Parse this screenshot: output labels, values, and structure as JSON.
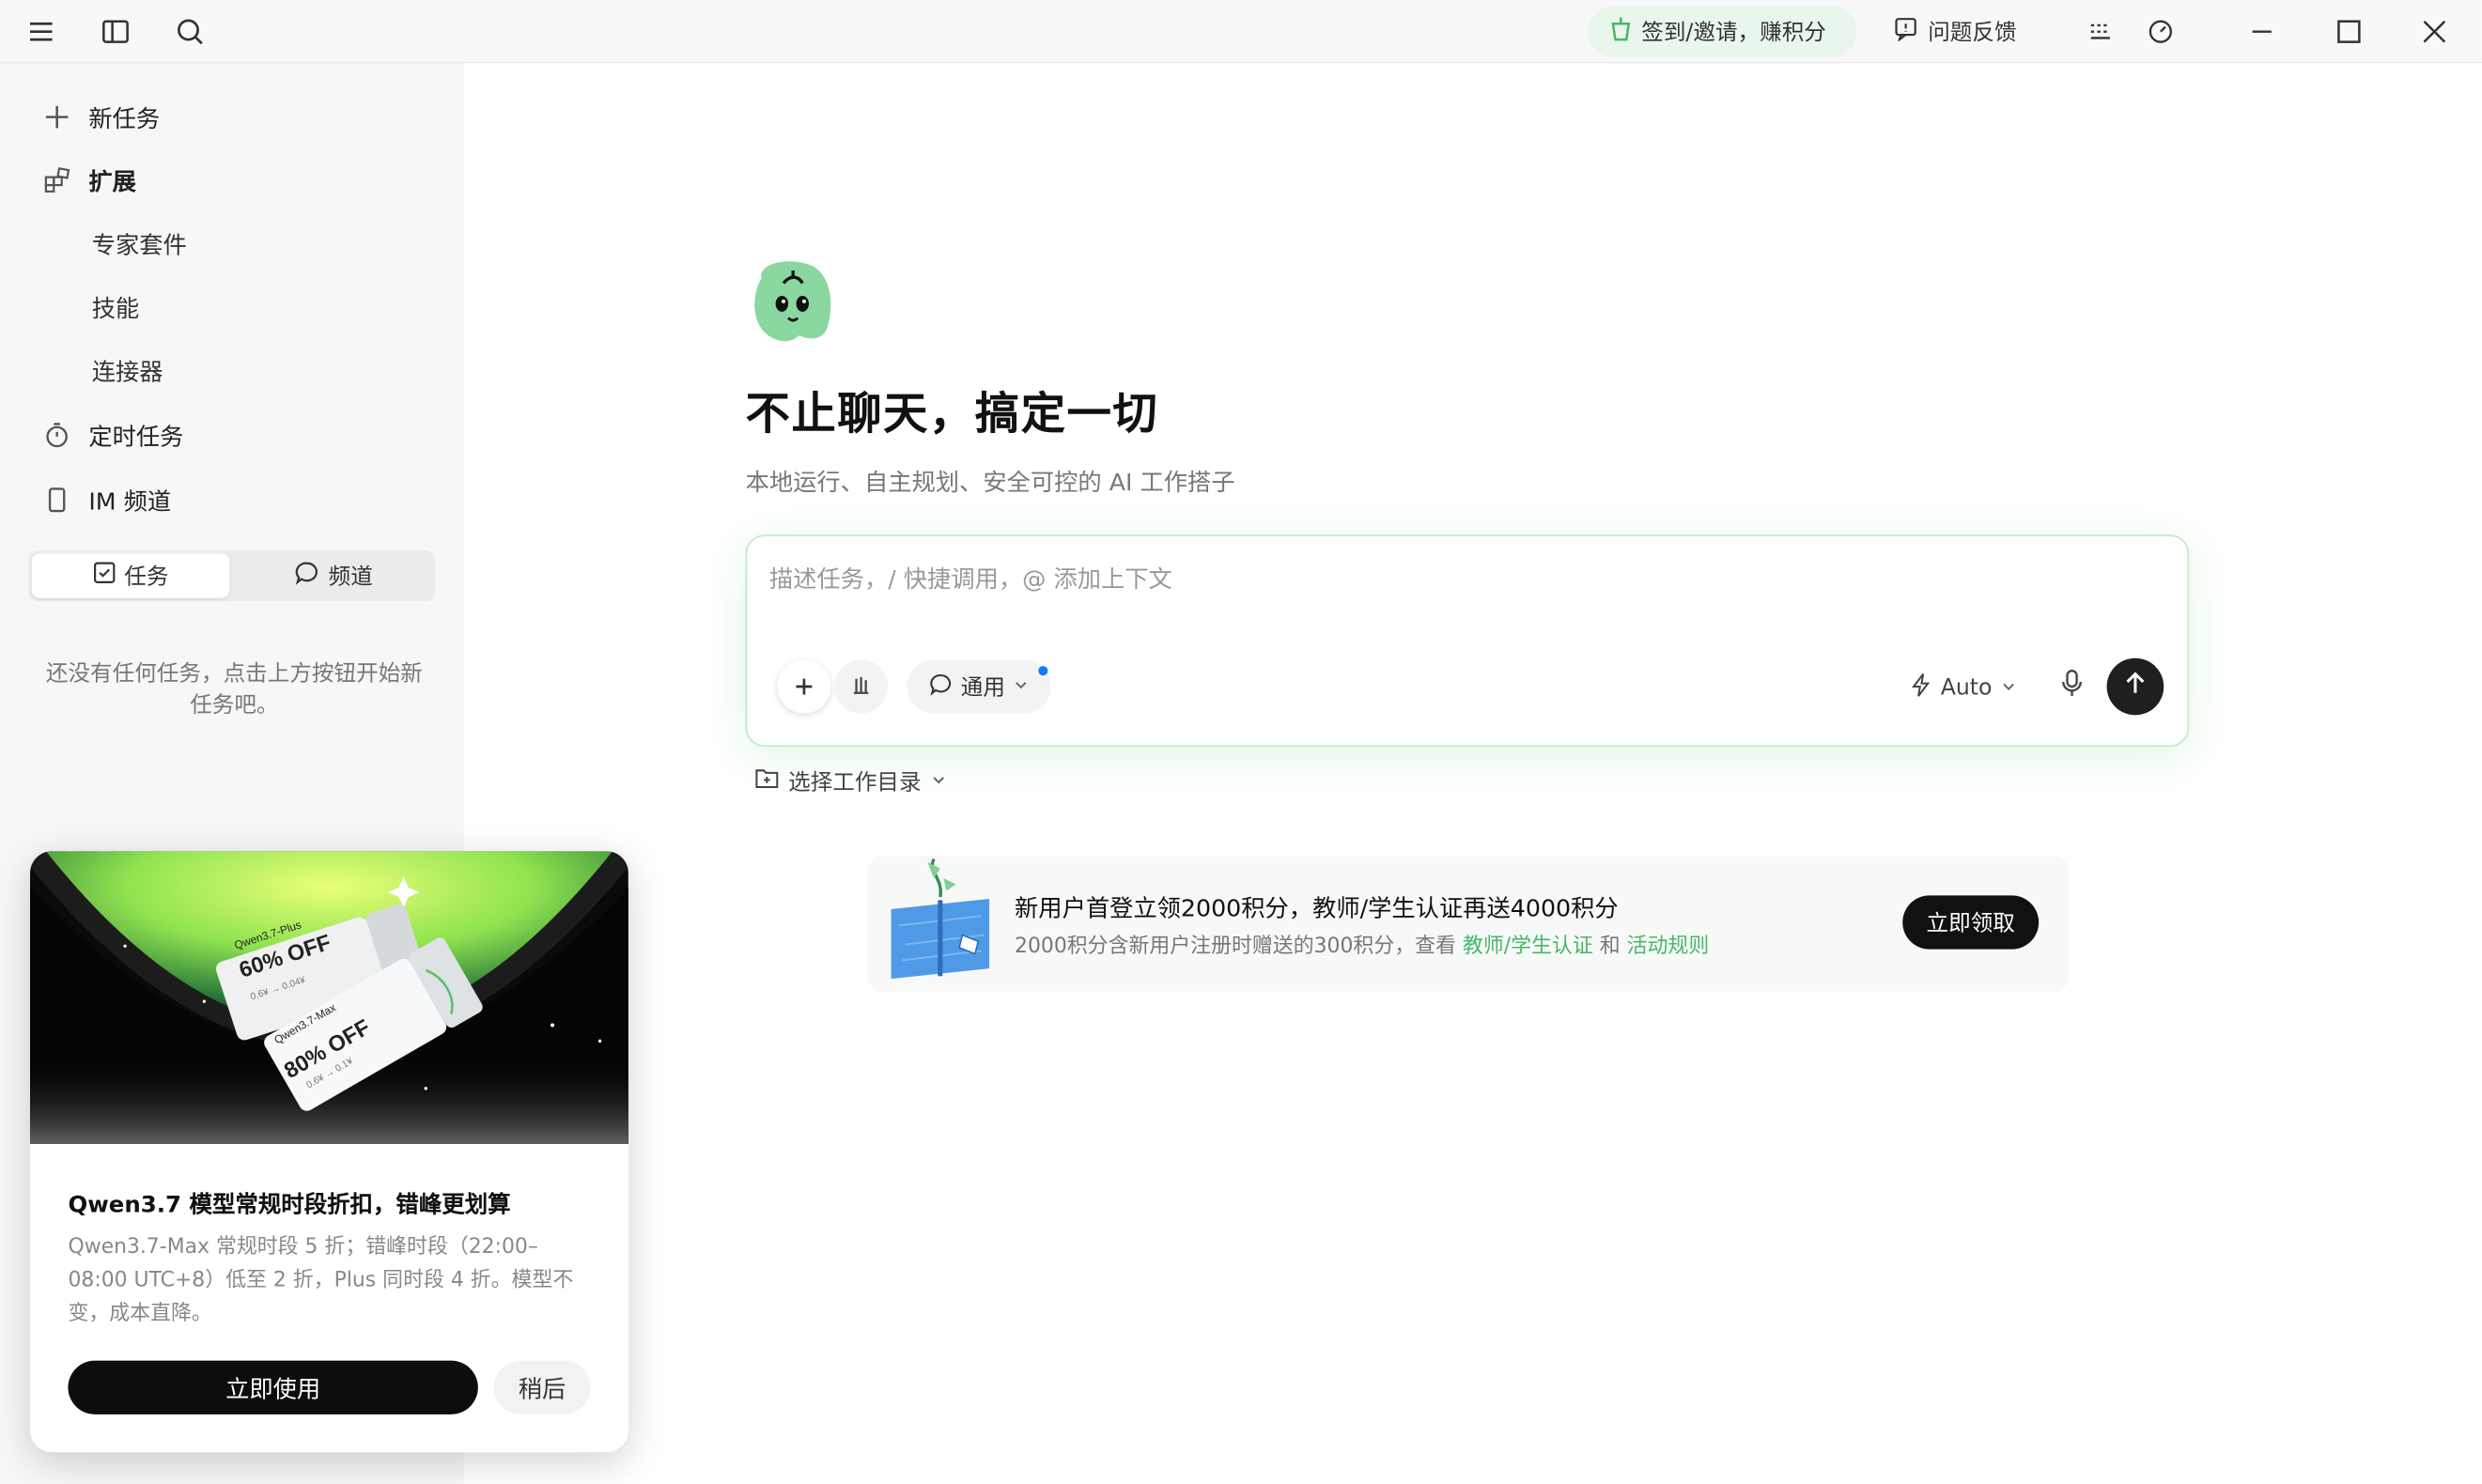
{
  "titlebar": {
    "checkin_label": "签到/邀请，赚积分",
    "feedback_label": "问题反馈"
  },
  "sidebar": {
    "new_task": "新任务",
    "extensions": "扩展",
    "sub_items": [
      "专家套件",
      "技能",
      "连接器"
    ],
    "scheduled": "定时任务",
    "im_channel": "IM 频道",
    "tabs": {
      "tasks": "任务",
      "channels": "频道"
    },
    "empty_text": "还没有任何任务，点击上方按钮开始新任务吧。"
  },
  "main": {
    "title": "不止聊天，搞定一切",
    "subtitle": "本地运行、自主规划、安全可控的 AI 工作搭子",
    "composer": {
      "placeholder": "描述任务，/ 快捷调用，@ 添加上下文",
      "mode": "通用",
      "model": "Auto"
    },
    "workdir": "选择工作目录",
    "promo": {
      "title": "新用户首登立领2000积分，教师/学生认证再送4000积分",
      "desc_prefix": "2000积分含新用户注册时赠送的300积分，查看",
      "link1": "教师/学生认证",
      "and": "和",
      "link2": "活动规则",
      "button": "立即领取"
    }
  },
  "popup": {
    "title": "Qwen3.7 模型常规时段折扣，错峰更划算",
    "desc": "Qwen3.7-Max 常规时段 5 折；错峰时段（22:00–08:00 UTC+8）低至 2 折，Plus 同时段 4 折。模型不变，成本直降。",
    "primary": "立即使用",
    "secondary": "稍后",
    "coupon1_name": "Qwen3.7-Plus",
    "coupon1_off": "60% OFF",
    "coupon1_sub": "0.6¥ → 0.04¥",
    "coupon2_name": "Qwen3.7-Max",
    "coupon2_off": "80% OFF",
    "coupon2_sub": "0.6¥ → 0.1¥"
  },
  "colors": {
    "accent_green": "#46b866",
    "dark_button": "#111111",
    "status_dot": "#1677ff"
  }
}
